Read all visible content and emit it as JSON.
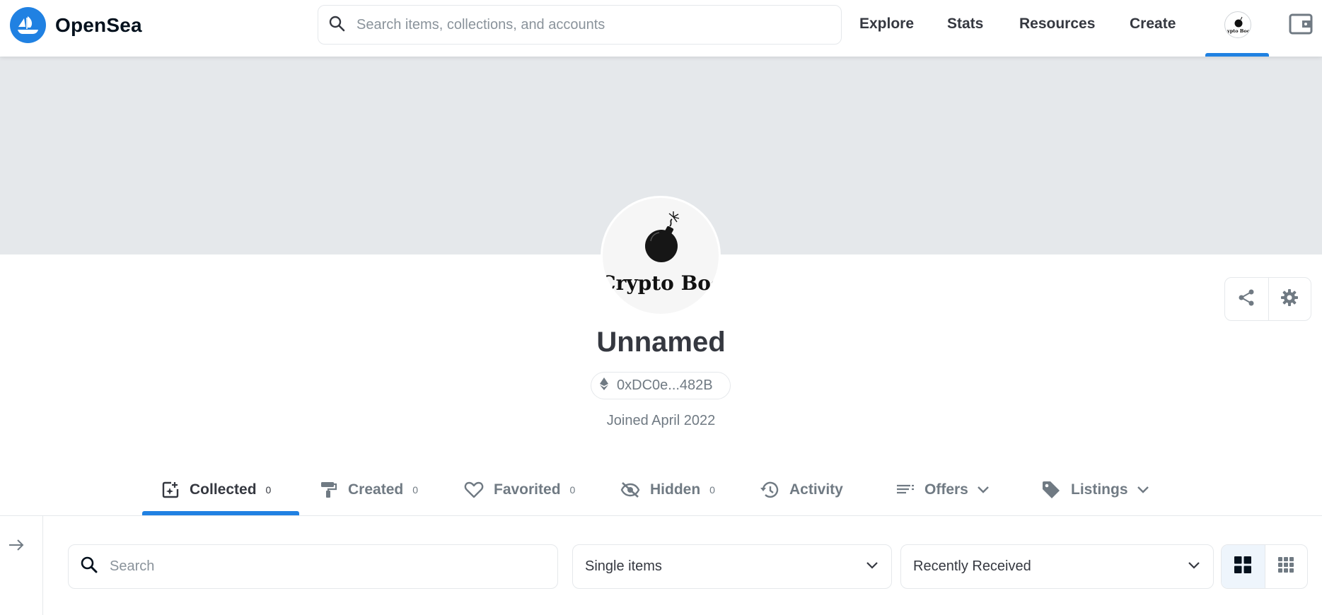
{
  "navbar": {
    "brand": "OpenSea",
    "search_placeholder": "Search items, collections, and accounts",
    "links": [
      "Explore",
      "Stats",
      "Resources",
      "Create"
    ]
  },
  "profile": {
    "avatar_text": "Crypto Boo",
    "name": "Unnamed",
    "address": "0xDC0e...482B",
    "joined": "Joined April 2022"
  },
  "tabs": [
    {
      "label": "Collected",
      "count": "0",
      "icon": "collected-icon",
      "active": true
    },
    {
      "label": "Created",
      "count": "0",
      "icon": "paint-roller-icon"
    },
    {
      "label": "Favorited",
      "count": "0",
      "icon": "heart-icon"
    },
    {
      "label": "Hidden",
      "count": "0",
      "icon": "eye-off-icon"
    },
    {
      "label": "Activity",
      "icon": "history-icon"
    },
    {
      "label": "Offers",
      "icon": "offers-list-icon",
      "dropdown": true
    },
    {
      "label": "Listings",
      "icon": "tag-icon",
      "dropdown": true
    }
  ],
  "filters": {
    "search_placeholder": "Search",
    "item_type": "Single items",
    "sort": "Recently Received"
  },
  "colors": {
    "accent": "#2081e2",
    "banner": "#e5e8eb",
    "text": "#353840",
    "muted": "#707a83"
  }
}
